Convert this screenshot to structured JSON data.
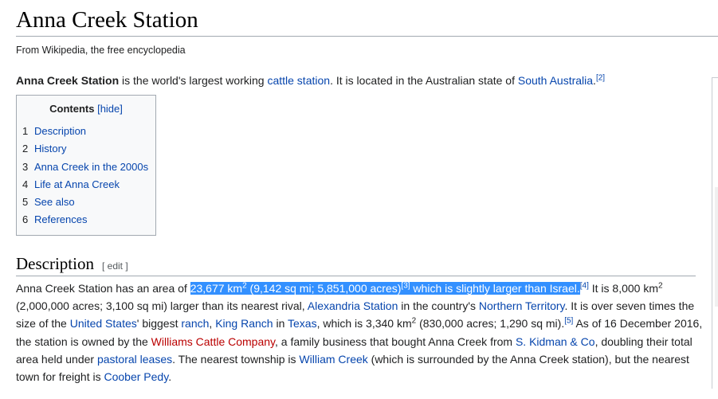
{
  "page": {
    "title": "Anna Creek Station",
    "tagline": "From Wikipedia, the free encyclopedia"
  },
  "lead": {
    "subject": "Anna Creek Station",
    "t1": " is the world's largest working ",
    "link_cattle": "cattle station",
    "t2": ". It is located in the Australian state of ",
    "link_sa": "South Australia",
    "t3": ".",
    "ref": "[2]"
  },
  "toc": {
    "heading": "Contents",
    "hide_label": "[hide]",
    "items": [
      {
        "num": "1",
        "label": "Description"
      },
      {
        "num": "2",
        "label": "History"
      },
      {
        "num": "3",
        "label": "Anna Creek in the 2000s"
      },
      {
        "num": "4",
        "label": "Life at Anna Creek"
      },
      {
        "num": "5",
        "label": "See also"
      },
      {
        "num": "6",
        "label": "References"
      }
    ]
  },
  "description": {
    "heading": "Description",
    "edit_label": "[ edit ]",
    "p1_start": "Anna Creek Station has an area of ",
    "sel_area": "23,677 km",
    "sel_sup2": "2",
    "sel_conv": " (9,142 sq mi; 5,851,000 acres)",
    "sel_ref": "[3]",
    "sel_tail": " which is slightly larger than Israel.",
    "ref4": "[4]",
    "t_8000": " It is 8,000 km",
    "sup2b": "2",
    "t_rival": " (2,000,000 acres; 3,100 sq mi) larger than its nearest rival, ",
    "link_alexandria": "Alexandria Station",
    "t_country": " in the country's ",
    "link_nt": "Northern Territory",
    "t_seven": ". It is over seven times the size of the ",
    "link_us": "United States",
    "t_biggest": "' biggest ",
    "link_ranch": "ranch",
    "t_comma": ", ",
    "link_king": "King Ranch",
    "t_in": " in ",
    "link_texas": "Texas",
    "t_which": ", which is 3,340 km",
    "sup2c": "2",
    "t_830": " (830,000 acres; 1,290 sq mi).",
    "ref5": "[5]",
    "t_asof": " As of 16 December 2016, the station is owned by the ",
    "link_williams": "Williams Cattle Company",
    "t_family": ", a family business that bought Anna Creek from ",
    "link_kidman": "S. Kidman & Co",
    "t_doubling": ", doubling their total area held under ",
    "link_pastoral": "pastoral leases",
    "t_nearest": ". The nearest township is ",
    "link_william": "William Creek",
    "t_surrounded": " (which is surrounded by the Anna Creek station), but the nearest town for freight is ",
    "link_coober": "Coober Pedy",
    "t_end": "."
  }
}
